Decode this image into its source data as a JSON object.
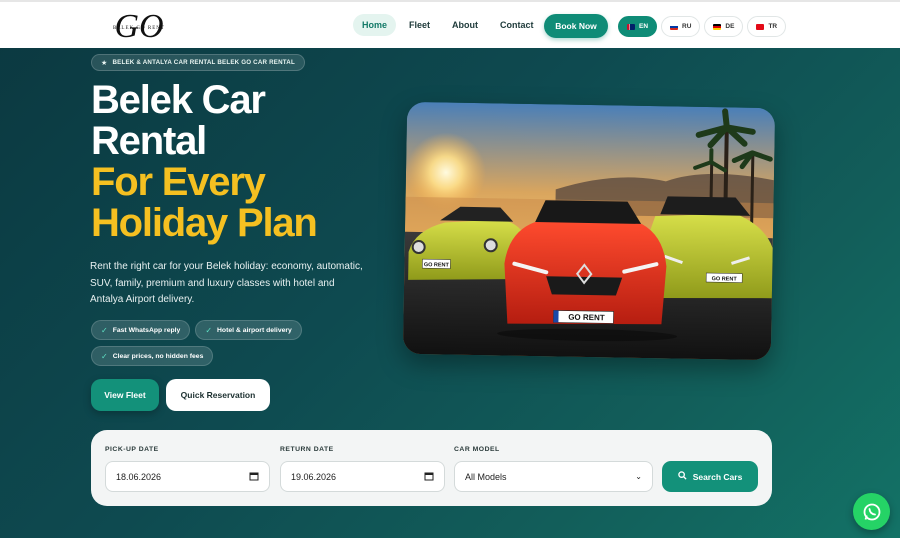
{
  "header": {
    "logo_main": "GO",
    "logo_small": "BELEK GO RENT",
    "nav": [
      {
        "label": "Home",
        "active": true
      },
      {
        "label": "Fleet",
        "active": false
      },
      {
        "label": "About",
        "active": false
      },
      {
        "label": "Contact",
        "active": false
      }
    ],
    "book_now": "Book Now",
    "languages": [
      {
        "code": "EN",
        "flag": "flag-en",
        "active": true
      },
      {
        "code": "RU",
        "flag": "flag-ru",
        "active": false
      },
      {
        "code": "DE",
        "flag": "flag-de",
        "active": false
      },
      {
        "code": "TR",
        "flag": "flag-tr",
        "active": false
      }
    ]
  },
  "hero": {
    "tagline": "BELEK & ANTALYA CAR RENTAL BELEK GO CAR RENTAL",
    "title_line1": "Belek Car",
    "title_line2": "Rental",
    "title_line3": "For Every",
    "title_line4": "Holiday Plan",
    "description": "Rent the right car for your Belek holiday: economy, automatic, SUV, family, premium and luxury classes with hotel and Antalya Airport delivery.",
    "features": [
      "Fast WhatsApp reply",
      "Hotel & airport delivery",
      "Clear prices, no hidden fees"
    ],
    "view_fleet": "View Fleet",
    "quick_reservation": "Quick Reservation",
    "plate_left": "GO RENT",
    "plate_center": "GO RENT",
    "plate_right": "GO RENT"
  },
  "search": {
    "pickup_label": "PICK-UP DATE",
    "pickup_value": "18.06.2026",
    "return_label": "RETURN DATE",
    "return_value": "19.06.2026",
    "model_label": "CAR MODEL",
    "model_value": "All Models",
    "search_button": "Search Cars"
  },
  "colors": {
    "accent": "#13917a",
    "gold": "#f5c021",
    "background_dark": "#0b3840"
  }
}
